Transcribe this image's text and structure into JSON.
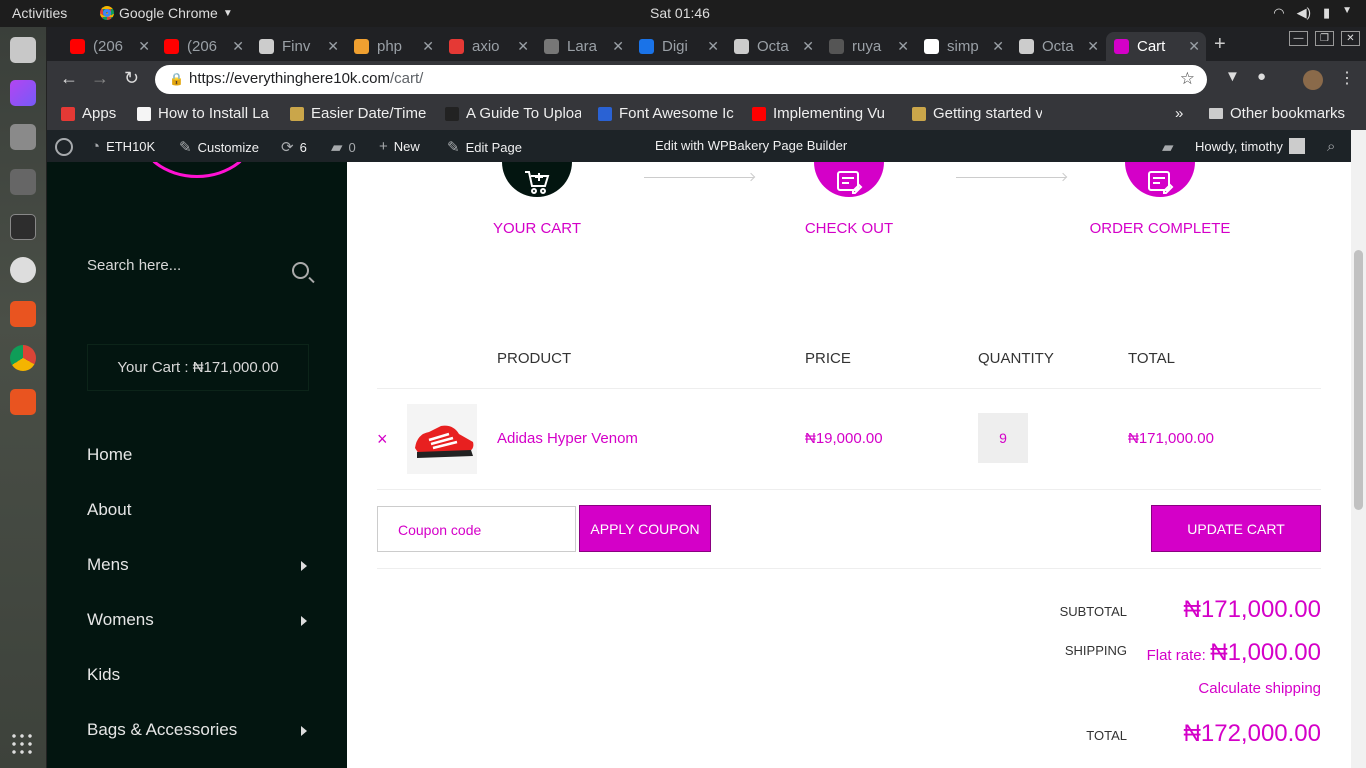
{
  "os": {
    "activities": "Activities",
    "app_name": "Google Chrome",
    "clock": "Sat 01:46"
  },
  "tabs": [
    {
      "title": "(206",
      "fav": "youtube-icon",
      "color": "#ff0000"
    },
    {
      "title": "(206",
      "fav": "youtube-icon",
      "color": "#ff0000"
    },
    {
      "title": "Finv",
      "fav": "document-icon",
      "color": "#cccccc"
    },
    {
      "title": "php",
      "fav": "php-icon",
      "color": "#f0a030"
    },
    {
      "title": "axio",
      "fav": "axios-icon",
      "color": "#e53935"
    },
    {
      "title": "Lara",
      "fav": "laravel-icon",
      "color": "#777777"
    },
    {
      "title": "Digi",
      "fav": "digitalocean-icon",
      "color": "#1a73e8"
    },
    {
      "title": "Octa",
      "fav": "document-icon",
      "color": "#cccccc"
    },
    {
      "title": "ruya",
      "fav": "github-icon",
      "color": "#555555"
    },
    {
      "title": "simp",
      "fav": "c-icon",
      "color": "#ffffff"
    },
    {
      "title": "Octa",
      "fav": "document-icon",
      "color": "#cccccc"
    },
    {
      "title": "Cart",
      "fav": "site-icon",
      "color": "#d400c8"
    }
  ],
  "omnibox": {
    "host": "https://everythinghere10k.com",
    "path": "/cart/"
  },
  "bookmarks": [
    {
      "label": "Apps",
      "color": "#e53935"
    },
    {
      "label": "How to Install La",
      "color": "#f5f5f5"
    },
    {
      "label": "Easier Date/Time",
      "color": "#caa64a"
    },
    {
      "label": "A Guide To Uploa",
      "color": "#222222"
    },
    {
      "label": "Font Awesome Ic",
      "color": "#2a62d4"
    },
    {
      "label": "Implementing Vu",
      "color": "#ff0000"
    },
    {
      "label": "Getting started v",
      "color": "#caa64a"
    }
  ],
  "bookmarks_more": "»",
  "other_bookmarks": "Other bookmarks",
  "admin": {
    "site": "ETH10K",
    "customize": "Customize",
    "updates": "6",
    "comments": "0",
    "new": "New",
    "edit_page": "Edit Page",
    "wpbakery": "Edit with WPBakery Page Builder",
    "howdy": "Howdy, timothy"
  },
  "sidebar": {
    "search_placeholder": "Search here...",
    "cart_summary": "Your Cart : ₦171,000.00",
    "menu": [
      {
        "label": "Home",
        "submenu": false
      },
      {
        "label": "About",
        "submenu": false
      },
      {
        "label": "Mens",
        "submenu": true
      },
      {
        "label": "Womens",
        "submenu": true
      },
      {
        "label": "Kids",
        "submenu": false
      },
      {
        "label": "Bags & Accessories",
        "submenu": true
      }
    ]
  },
  "steps": [
    {
      "label": "YOUR CART",
      "icon": "cart-icon",
      "bg": "#031510"
    },
    {
      "label": "CHECK OUT",
      "icon": "form-edit-icon",
      "bg": "#d400c8"
    },
    {
      "label": "ORDER COMPLETE",
      "icon": "form-edit-icon",
      "bg": "#d400c8"
    }
  ],
  "table": {
    "headers": {
      "product": "PRODUCT",
      "price": "PRICE",
      "quantity": "QUANTITY",
      "total": "TOTAL"
    },
    "rows": [
      {
        "remove": "×",
        "name": "Adidas Hyper Venom",
        "price": "₦19,000.00",
        "qty": "9",
        "total": "₦171,000.00"
      }
    ]
  },
  "coupon": {
    "placeholder": "Coupon code",
    "apply": "APPLY COUPON",
    "update": "UPDATE CART"
  },
  "totals": {
    "subtotal_label": "SUBTOTAL",
    "subtotal": "₦171,000.00",
    "shipping_label": "SHIPPING",
    "shipping_prefix": "Flat rate:",
    "shipping": "₦1,000.00",
    "calc_shipping": "Calculate shipping",
    "total_label": "TOTAL",
    "total": "₦172,000.00"
  },
  "colors": {
    "accent": "#d400c8",
    "sidebar_bg": "#031510",
    "admin_bg": "#1d2327"
  }
}
